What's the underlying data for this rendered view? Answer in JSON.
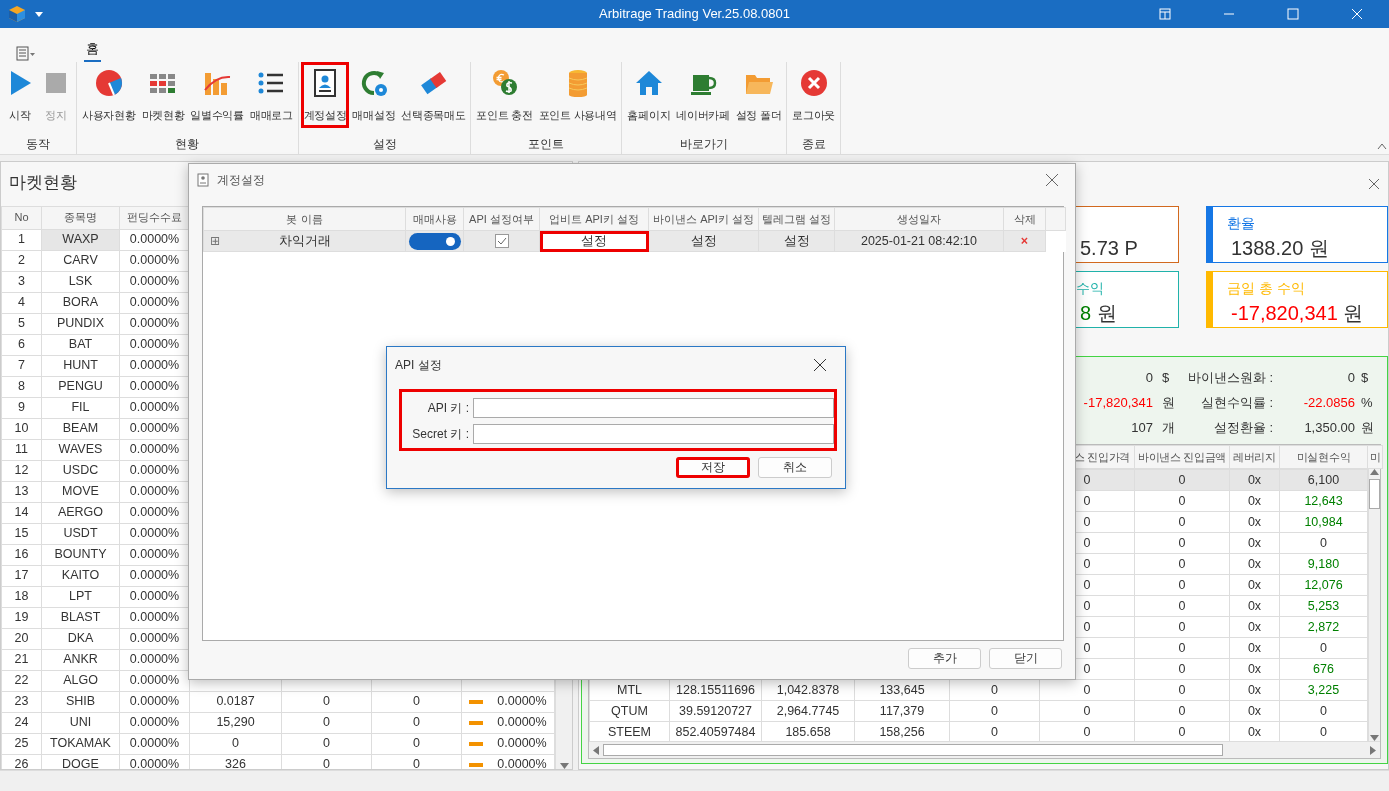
{
  "window": {
    "title": "Arbitrage Trading Ver.25.08.0801"
  },
  "ribbon": {
    "tabs": [
      {
        "label": "홈",
        "selected": true
      }
    ],
    "groups": [
      {
        "label": "동작",
        "buttons": [
          {
            "label": "시작",
            "disabled": false,
            "highlighted": false
          },
          {
            "label": "정지",
            "disabled": true,
            "highlighted": false
          }
        ]
      },
      {
        "label": "현황",
        "buttons": [
          {
            "label": "사용자현황",
            "disabled": false,
            "highlighted": false
          },
          {
            "label": "마켓현황",
            "disabled": false,
            "highlighted": false
          },
          {
            "label": "일별수익률",
            "disabled": false,
            "highlighted": false
          },
          {
            "label": "매매로그",
            "disabled": false,
            "highlighted": false
          }
        ]
      },
      {
        "label": "설정",
        "buttons": [
          {
            "label": "계정설정",
            "disabled": false,
            "highlighted": true
          },
          {
            "label": "매매설정",
            "disabled": false,
            "highlighted": false
          },
          {
            "label": "선택종목매도",
            "disabled": false,
            "highlighted": false
          }
        ]
      },
      {
        "label": "포인트",
        "buttons": [
          {
            "label": "포인트 충전",
            "disabled": false,
            "highlighted": false
          },
          {
            "label": "포인트 사용내역",
            "disabled": false,
            "highlighted": false
          }
        ]
      },
      {
        "label": "바로가기",
        "buttons": [
          {
            "label": "홈페이지",
            "disabled": false,
            "highlighted": false
          },
          {
            "label": "네이버카페",
            "disabled": false,
            "highlighted": false
          },
          {
            "label": "설정 폴더",
            "disabled": false,
            "highlighted": false
          }
        ]
      },
      {
        "label": "종료",
        "buttons": [
          {
            "label": "로그아웃",
            "disabled": false,
            "highlighted": false
          }
        ]
      }
    ]
  },
  "market_panel": {
    "title": "마켓현황",
    "table": {
      "columns": [
        "No",
        "종목명",
        "펀딩수수료"
      ],
      "rows": [
        {
          "cells": [
            "1",
            "WAXP",
            "0.0000%"
          ],
          "selected": true
        },
        {
          "cells": [
            "2",
            "CARV",
            "0.0000%"
          ],
          "selected": false
        },
        {
          "cells": [
            "3",
            "LSK",
            "0.0000%"
          ],
          "selected": false
        },
        {
          "cells": [
            "4",
            "BORA",
            "0.0000%"
          ],
          "selected": false
        },
        {
          "cells": [
            "5",
            "PUNDIX",
            "0.0000%"
          ],
          "selected": false
        },
        {
          "cells": [
            "6",
            "BAT",
            "0.0000%"
          ],
          "selected": false
        },
        {
          "cells": [
            "7",
            "HUNT",
            "0.0000%"
          ],
          "selected": false
        },
        {
          "cells": [
            "8",
            "PENGU",
            "0.0000%"
          ],
          "selected": false
        },
        {
          "cells": [
            "9",
            "FIL",
            "0.0000%"
          ],
          "selected": false
        },
        {
          "cells": [
            "10",
            "BEAM",
            "0.0000%"
          ],
          "selected": false
        },
        {
          "cells": [
            "11",
            "WAVES",
            "0.0000%"
          ],
          "selected": false
        },
        {
          "cells": [
            "12",
            "USDC",
            "0.0000%"
          ],
          "selected": false
        },
        {
          "cells": [
            "13",
            "MOVE",
            "0.0000%"
          ],
          "selected": false
        },
        {
          "cells": [
            "14",
            "AERGO",
            "0.0000%"
          ],
          "selected": false
        },
        {
          "cells": [
            "15",
            "USDT",
            "0.0000%"
          ],
          "selected": false
        },
        {
          "cells": [
            "16",
            "BOUNTY",
            "0.0000%"
          ],
          "selected": false
        },
        {
          "cells": [
            "17",
            "KAITO",
            "0.0000%"
          ],
          "selected": false
        },
        {
          "cells": [
            "18",
            "LPT",
            "0.0000%"
          ],
          "selected": false
        },
        {
          "cells": [
            "19",
            "BLAST",
            "0.0000%"
          ],
          "selected": false
        },
        {
          "cells": [
            "20",
            "DKA",
            "0.0000%"
          ],
          "selected": false
        },
        {
          "cells": [
            "21",
            "ANKR",
            "0.0000%"
          ],
          "selected": false
        },
        {
          "cells": [
            "22",
            "ALGO",
            "0.0000%"
          ],
          "selected": false
        },
        {
          "cells": [
            "23",
            "SHIB",
            "0.0000%",
            "0.0187",
            "0",
            "0",
            "0.0000%"
          ],
          "selected": false
        },
        {
          "cells": [
            "24",
            "UNI",
            "0.0000%",
            "15,290",
            "0",
            "0",
            "0.0000%"
          ],
          "selected": false
        },
        {
          "cells": [
            "25",
            "TOKAMAK",
            "0.0000%",
            "0",
            "0",
            "0",
            "0.0000%"
          ],
          "selected": false
        },
        {
          "cells": [
            "26",
            "DOGE",
            "0.0000%",
            "326",
            "0",
            "0",
            "0.0000%"
          ],
          "selected": false
        }
      ]
    }
  },
  "right_panel": {
    "cards": [
      {
        "value": "5.73 P",
        "color": "#d2691e",
        "gain": false,
        "loss": false
      },
      {
        "title": "수익",
        "value": "8",
        "unit": "원",
        "color": "#20b2aa",
        "gain": true,
        "loss": false
      },
      {
        "title": "환율",
        "value": "1388.20",
        "unit": "원",
        "color": "#1677e5",
        "gain": false,
        "loss": false
      },
      {
        "title": "금일 총 수익",
        "value": "-17,820,341",
        "unit": "원",
        "color": "#ffb900",
        "gain": false,
        "loss": true
      }
    ],
    "summary": [
      {
        "value": "0",
        "unit": "$",
        "label": "바이낸스원화 :",
        "value2": "0",
        "unit2": "$",
        "loss": false
      },
      {
        "value": "-17,820,341",
        "unit": "원",
        "label": "실현수익률 :",
        "value2": "-22.0856",
        "unit2": "%",
        "loss": true
      },
      {
        "value": "107",
        "unit": "개",
        "label": "설정환율 :",
        "value2": "1,350.00",
        "unit2": "원",
        "loss": false
      }
    ],
    "table": {
      "columns": [
        "스 진입가격",
        "바이낸스 진입금액",
        "레버리지",
        "미실현수익",
        "미"
      ],
      "rows": [
        {
          "cells": [
            "0",
            "0",
            "0x",
            "6,100"
          ],
          "selected": true,
          "gain": false
        },
        {
          "cells": [
            "0",
            "0",
            "0x",
            "12,643"
          ],
          "selected": false,
          "gain": true
        },
        {
          "cells": [
            "0",
            "0",
            "0x",
            "10,984"
          ],
          "selected": false,
          "gain": true
        },
        {
          "cells": [
            "0",
            "0",
            "0x",
            "0"
          ],
          "selected": false,
          "gain": false
        },
        {
          "cells": [
            "0",
            "0",
            "0x",
            "9,180"
          ],
          "selected": false,
          "gain": true
        },
        {
          "cells": [
            "0",
            "0",
            "0x",
            "12,076"
          ],
          "selected": false,
          "gain": true
        },
        {
          "cells": [
            "0",
            "0",
            "0x",
            "5,253"
          ],
          "selected": false,
          "gain": true
        },
        {
          "cells": [
            "0",
            "0",
            "0x",
            "2,872"
          ],
          "selected": false,
          "gain": true
        },
        {
          "cells": [
            "0",
            "0",
            "0x",
            "0"
          ],
          "selected": false,
          "gain": false
        },
        {
          "cells": [
            "0",
            "0",
            "0x",
            "676"
          ],
          "selected": false,
          "gain": true
        },
        {
          "cells": [
            "MTL",
            "128.15511696",
            "1,042.8378",
            "133,645",
            "0",
            "0",
            "0",
            "0x",
            "3,225"
          ],
          "selected": false,
          "gain": true
        },
        {
          "cells": [
            "QTUM",
            "39.59120727",
            "2,964.7745",
            "117,379",
            "0",
            "0",
            "0",
            "0x",
            "0"
          ],
          "selected": false,
          "gain": false
        },
        {
          "cells": [
            "STEEM",
            "852.40597484",
            "185.658",
            "158,256",
            "0",
            "0",
            "0",
            "0x",
            "0"
          ],
          "selected": false,
          "gain": false
        }
      ]
    }
  },
  "account_dialog": {
    "title": "계정설정",
    "columns": [
      "봇 이름",
      "매매사용",
      "API 설정여부",
      "업비트 API키 설정",
      "바이낸스 API키 설정",
      "텔레그램 설정",
      "생성일자",
      "삭제"
    ],
    "rows": [
      {
        "expand": "⊞",
        "name": "차익거래",
        "trading_on": true,
        "api_set": true,
        "upbit": {
          "label": "설정",
          "highlighted": true
        },
        "binance": {
          "label": "설정",
          "highlighted": false
        },
        "telegram": {
          "label": "설정",
          "highlighted": false
        },
        "created": "2025-01-21 08:42:10",
        "delete": "×"
      }
    ],
    "buttons": [
      "추가",
      "닫기"
    ]
  },
  "api_dialog": {
    "title": "API 설정",
    "fields_highlighted": true,
    "fields": [
      {
        "label": "API 키 :"
      },
      {
        "label": "Secret 키 :"
      }
    ],
    "buttons": [
      {
        "label": "저장",
        "highlighted": true
      },
      {
        "label": "취소",
        "highlighted": false
      }
    ]
  }
}
